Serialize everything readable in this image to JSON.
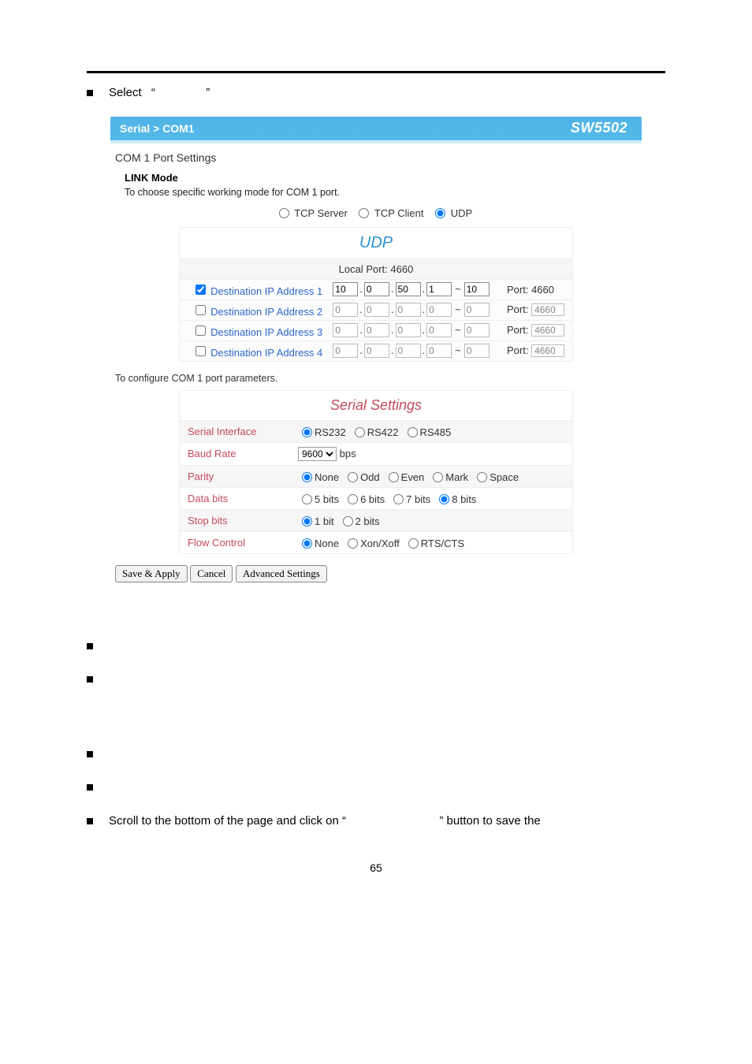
{
  "intro_bullet": {
    "prefix": "Select  ",
    "quote_open": "“",
    "quoted": "",
    "quote_close": "”"
  },
  "shot": {
    "breadcrumb": "Serial > COM1",
    "model": "SW5502",
    "section_title": "COM 1 Port Settings",
    "link_mode_label": "LINK Mode",
    "link_mode_sub": "To choose specific working mode for COM 1 port.",
    "modes": {
      "tcpserver": "TCP Server",
      "tcpclient": "TCP Client",
      "udp": "UDP"
    },
    "udp": {
      "title": "UDP",
      "local_port_label": "Local Port:",
      "local_port_value": "4660",
      "port_label": "Port:",
      "rows": [
        {
          "name": "dest-ip-1",
          "label": "Destination IP Address 1",
          "checked": true,
          "octets": [
            "10",
            "0",
            "50",
            "1"
          ],
          "range_end": "10",
          "port": "4660",
          "port_editable": true
        },
        {
          "name": "dest-ip-2",
          "label": "Destination IP Address 2",
          "checked": false,
          "octets": [
            "0",
            "0",
            "0",
            "0"
          ],
          "range_end": "0",
          "port": "4660",
          "port_editable": false
        },
        {
          "name": "dest-ip-3",
          "label": "Destination IP Address 3",
          "checked": false,
          "octets": [
            "0",
            "0",
            "0",
            "0"
          ],
          "range_end": "0",
          "port": "4660",
          "port_editable": false
        },
        {
          "name": "dest-ip-4",
          "label": "Destination IP Address 4",
          "checked": false,
          "octets": [
            "0",
            "0",
            "0",
            "0"
          ],
          "range_end": "0",
          "port": "4660",
          "port_editable": false
        }
      ]
    },
    "params_sub": "To configure COM 1 port parameters.",
    "serial": {
      "title": "Serial Settings",
      "rows": {
        "serial_interface": {
          "label": "Serial Interface",
          "opts": [
            "RS232",
            "RS422",
            "RS485"
          ],
          "selected": 0
        },
        "baud_rate": {
          "label": "Baud Rate",
          "value": "9600",
          "unit": "bps"
        },
        "parity": {
          "label": "Parity",
          "opts": [
            "None",
            "Odd",
            "Even",
            "Mark",
            "Space"
          ],
          "selected": 0
        },
        "data_bits": {
          "label": "Data bits",
          "opts": [
            "5 bits",
            "6 bits",
            "7 bits",
            "8 bits"
          ],
          "selected": 3
        },
        "stop_bits": {
          "label": "Stop bits",
          "opts": [
            "1 bit",
            "2 bits"
          ],
          "selected": 0
        },
        "flow_control": {
          "label": "Flow Control",
          "opts": [
            "None",
            "Xon/Xoff",
            "RTS/CTS"
          ],
          "selected": 0
        }
      }
    },
    "buttons": {
      "save_apply": "Save & Apply",
      "cancel": "Cancel",
      "advanced": "Advanced Settings"
    }
  },
  "final_bullet": {
    "text_a": "Scroll  to  the  bottom  of  the  page  and  click  on  “",
    "text_b": "”  button  to  save  the"
  },
  "pagenum": "65"
}
